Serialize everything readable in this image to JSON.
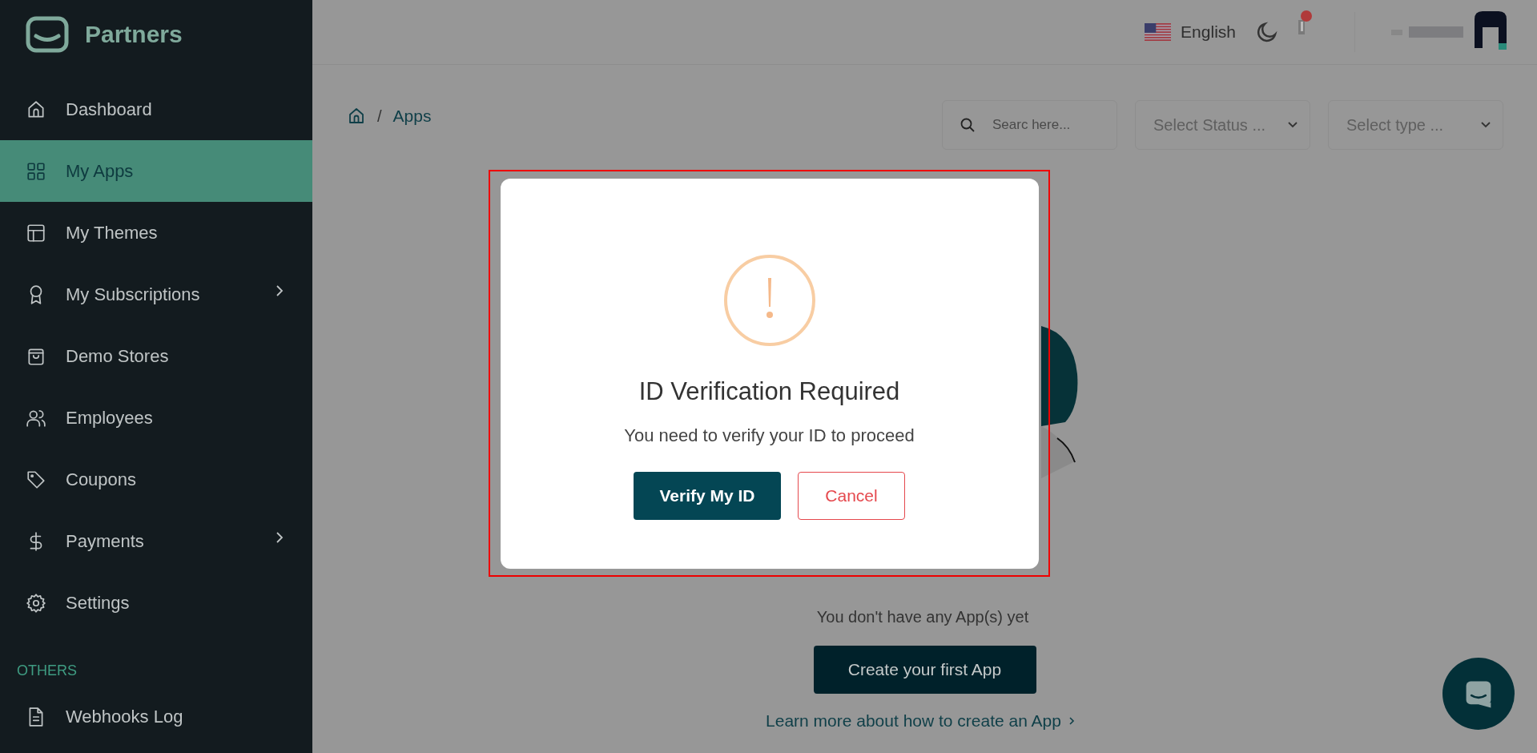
{
  "brand": {
    "name": "Partners"
  },
  "sidebar": {
    "items": [
      {
        "label": "Dashboard",
        "selected": false,
        "submenu": false
      },
      {
        "label": "My Apps",
        "selected": true,
        "submenu": false
      },
      {
        "label": "My Themes",
        "selected": false,
        "submenu": false
      },
      {
        "label": "My Subscriptions",
        "selected": false,
        "submenu": true
      },
      {
        "label": "Demo Stores",
        "selected": false,
        "submenu": false
      },
      {
        "label": "Employees",
        "selected": false,
        "submenu": false
      },
      {
        "label": "Coupons",
        "selected": false,
        "submenu": false
      },
      {
        "label": "Payments",
        "selected": false,
        "submenu": true
      },
      {
        "label": "Settings",
        "selected": false,
        "submenu": false
      }
    ],
    "section": "OTHERS",
    "section_items": [
      {
        "label": "Webhooks Log",
        "selected": false,
        "submenu": false
      }
    ]
  },
  "topbar": {
    "language": "English"
  },
  "breadcrumb": {
    "separator": "/",
    "items": [
      "Apps"
    ]
  },
  "filters": {
    "search": {
      "placeholder": "Searc here..."
    },
    "selects": [
      {
        "placeholder": "Select Status ..."
      },
      {
        "placeholder": "Select type ..."
      }
    ]
  },
  "empty_state": {
    "message": "You don't have any App(s) yet",
    "button": "Create your first App",
    "link": "Learn more about how to create an App"
  },
  "modal": {
    "title": "ID Verification Required",
    "message": "You need to verify your ID to proceed",
    "buttons": [
      {
        "label": "Verify My ID",
        "kind": "primary"
      },
      {
        "label": "Cancel",
        "kind": "outline"
      }
    ]
  }
}
